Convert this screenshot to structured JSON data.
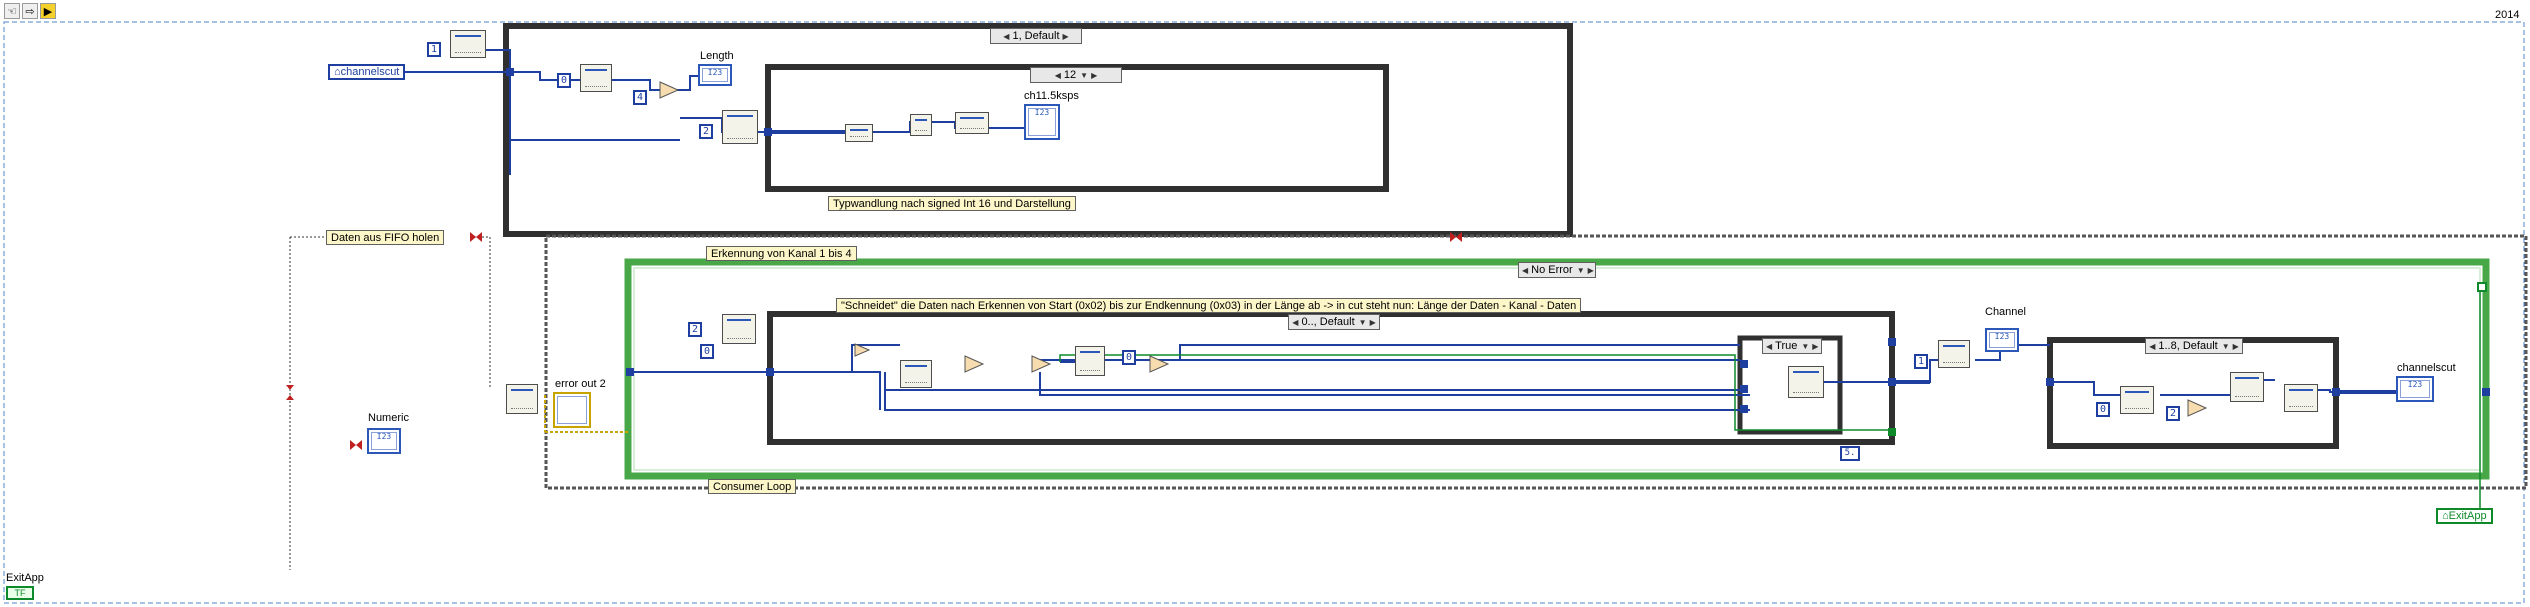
{
  "toolbar": {
    "buttons": [
      "pointer-tool",
      "step-over",
      "highlight-execution"
    ],
    "version_label": "2014"
  },
  "case_structures": {
    "outer_top": {
      "selector": "1, Default"
    },
    "inner_top": {
      "selector": "12"
    },
    "error_case": {
      "selector": "No Error"
    },
    "inner_consumer": {
      "selector": "0.., Default"
    },
    "true_case": {
      "selector": "True"
    },
    "right_case": {
      "selector": "1..8, Default"
    }
  },
  "comments": {
    "typwandlung": "Typwandlung nach signed Int 16 und Darstellung",
    "daten_fifo": "Daten aus FIFO holen",
    "erkennung": "Erkennung von Kanal 1 bis 4",
    "schneidet": "\"Schneidet\" die Daten nach Erkennen von Start (0x02) bis zur Endkennung (0x03) in der Länge ab -> in cut steht nun: Länge der Daten - Kanal - Daten",
    "consumer_loop": "Consumer Loop"
  },
  "labels": {
    "length": "Length",
    "ch11": "ch11.5ksps",
    "channel": "Channel",
    "channelscut_right": "channelscut",
    "numeric": "Numeric",
    "error_out": "error out 2",
    "exitapp_label": "ExitApp"
  },
  "locals": {
    "channelscut": "channelscut",
    "exitapp": "ExitApp"
  },
  "indicator_text": "I23",
  "constants": {
    "c1": "1",
    "c0a": "0",
    "c4": "4",
    "c2a": "2",
    "c2b": "2",
    "c0b": "0",
    "c0c": "0",
    "c1b": "1",
    "c0d": "0",
    "c2c": "2",
    "loop_count": "5."
  },
  "colors": {
    "wire_int": "#1f3fa0",
    "wire_bool": "#0f8a2a",
    "wire_error": "#c8a400",
    "case_border": "#333333",
    "loop_border": "#3aa83a"
  }
}
